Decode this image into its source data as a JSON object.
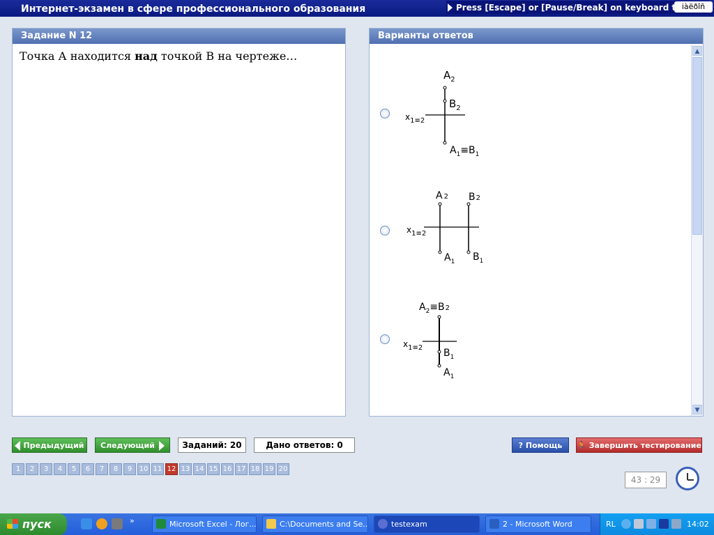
{
  "title_bar": {
    "title": "Интернет-экзамен в сфере профессионального образования",
    "hint": "Press [Escape] or [Pause/Break] on keyboard to stop",
    "lang": "iàëðîñ"
  },
  "task_panel": {
    "header": "Задание N 12",
    "question_part1": "Точка А находится ",
    "question_bold": "над",
    "question_part2": " точкой В на чертеже…"
  },
  "answers_panel": {
    "header": "Варианты ответов",
    "options": [
      {
        "axis_label": "x",
        "axis_sub": "1≡2",
        "labels": {
          "a2": "A",
          "a2_sub": "2",
          "b2": "B",
          "b2_sub": "2",
          "a1b1": "A",
          "a1b1_sub": "1",
          "eq": "≡B",
          "eq_sub": "1"
        }
      },
      {
        "axis_label": "x",
        "axis_sub": "1≡2",
        "labels": {
          "a2": "A",
          "a2_sub": "2",
          "b2": "B",
          "b2_sub": "2",
          "a1": "A",
          "a1_sub": "1",
          "b1": "B",
          "b1_sub": "1"
        }
      },
      {
        "axis_label": "x",
        "axis_sub": "1≡2",
        "labels": {
          "a2b2": "A",
          "a2b2_sub": "2",
          "eq": "≡B",
          "eq_sub": "2",
          "b1": "B",
          "b1_sub": "1",
          "a1": "A",
          "a1_sub": "1"
        }
      }
    ]
  },
  "controls": {
    "prev": "Предыдущий",
    "next": "Следующий",
    "tasks_count": "Заданий: 20",
    "answers_given": "Дано ответов: 0",
    "help": "Помощь",
    "finish": "Завершить тестирование"
  },
  "pager": {
    "pages": [
      "1",
      "2",
      "3",
      "4",
      "5",
      "6",
      "7",
      "8",
      "9",
      "10",
      "11",
      "12",
      "13",
      "14",
      "15",
      "16",
      "17",
      "18",
      "19",
      "20"
    ],
    "current": "12"
  },
  "timer": "43 : 29",
  "taskbar": {
    "start": "пуск",
    "tasks": [
      "Microsoft Excel - Лог...",
      "C:\\Documents and Se...",
      "testexam",
      "2 - Microsoft Word"
    ],
    "lang": "RL",
    "time": "14:02"
  }
}
